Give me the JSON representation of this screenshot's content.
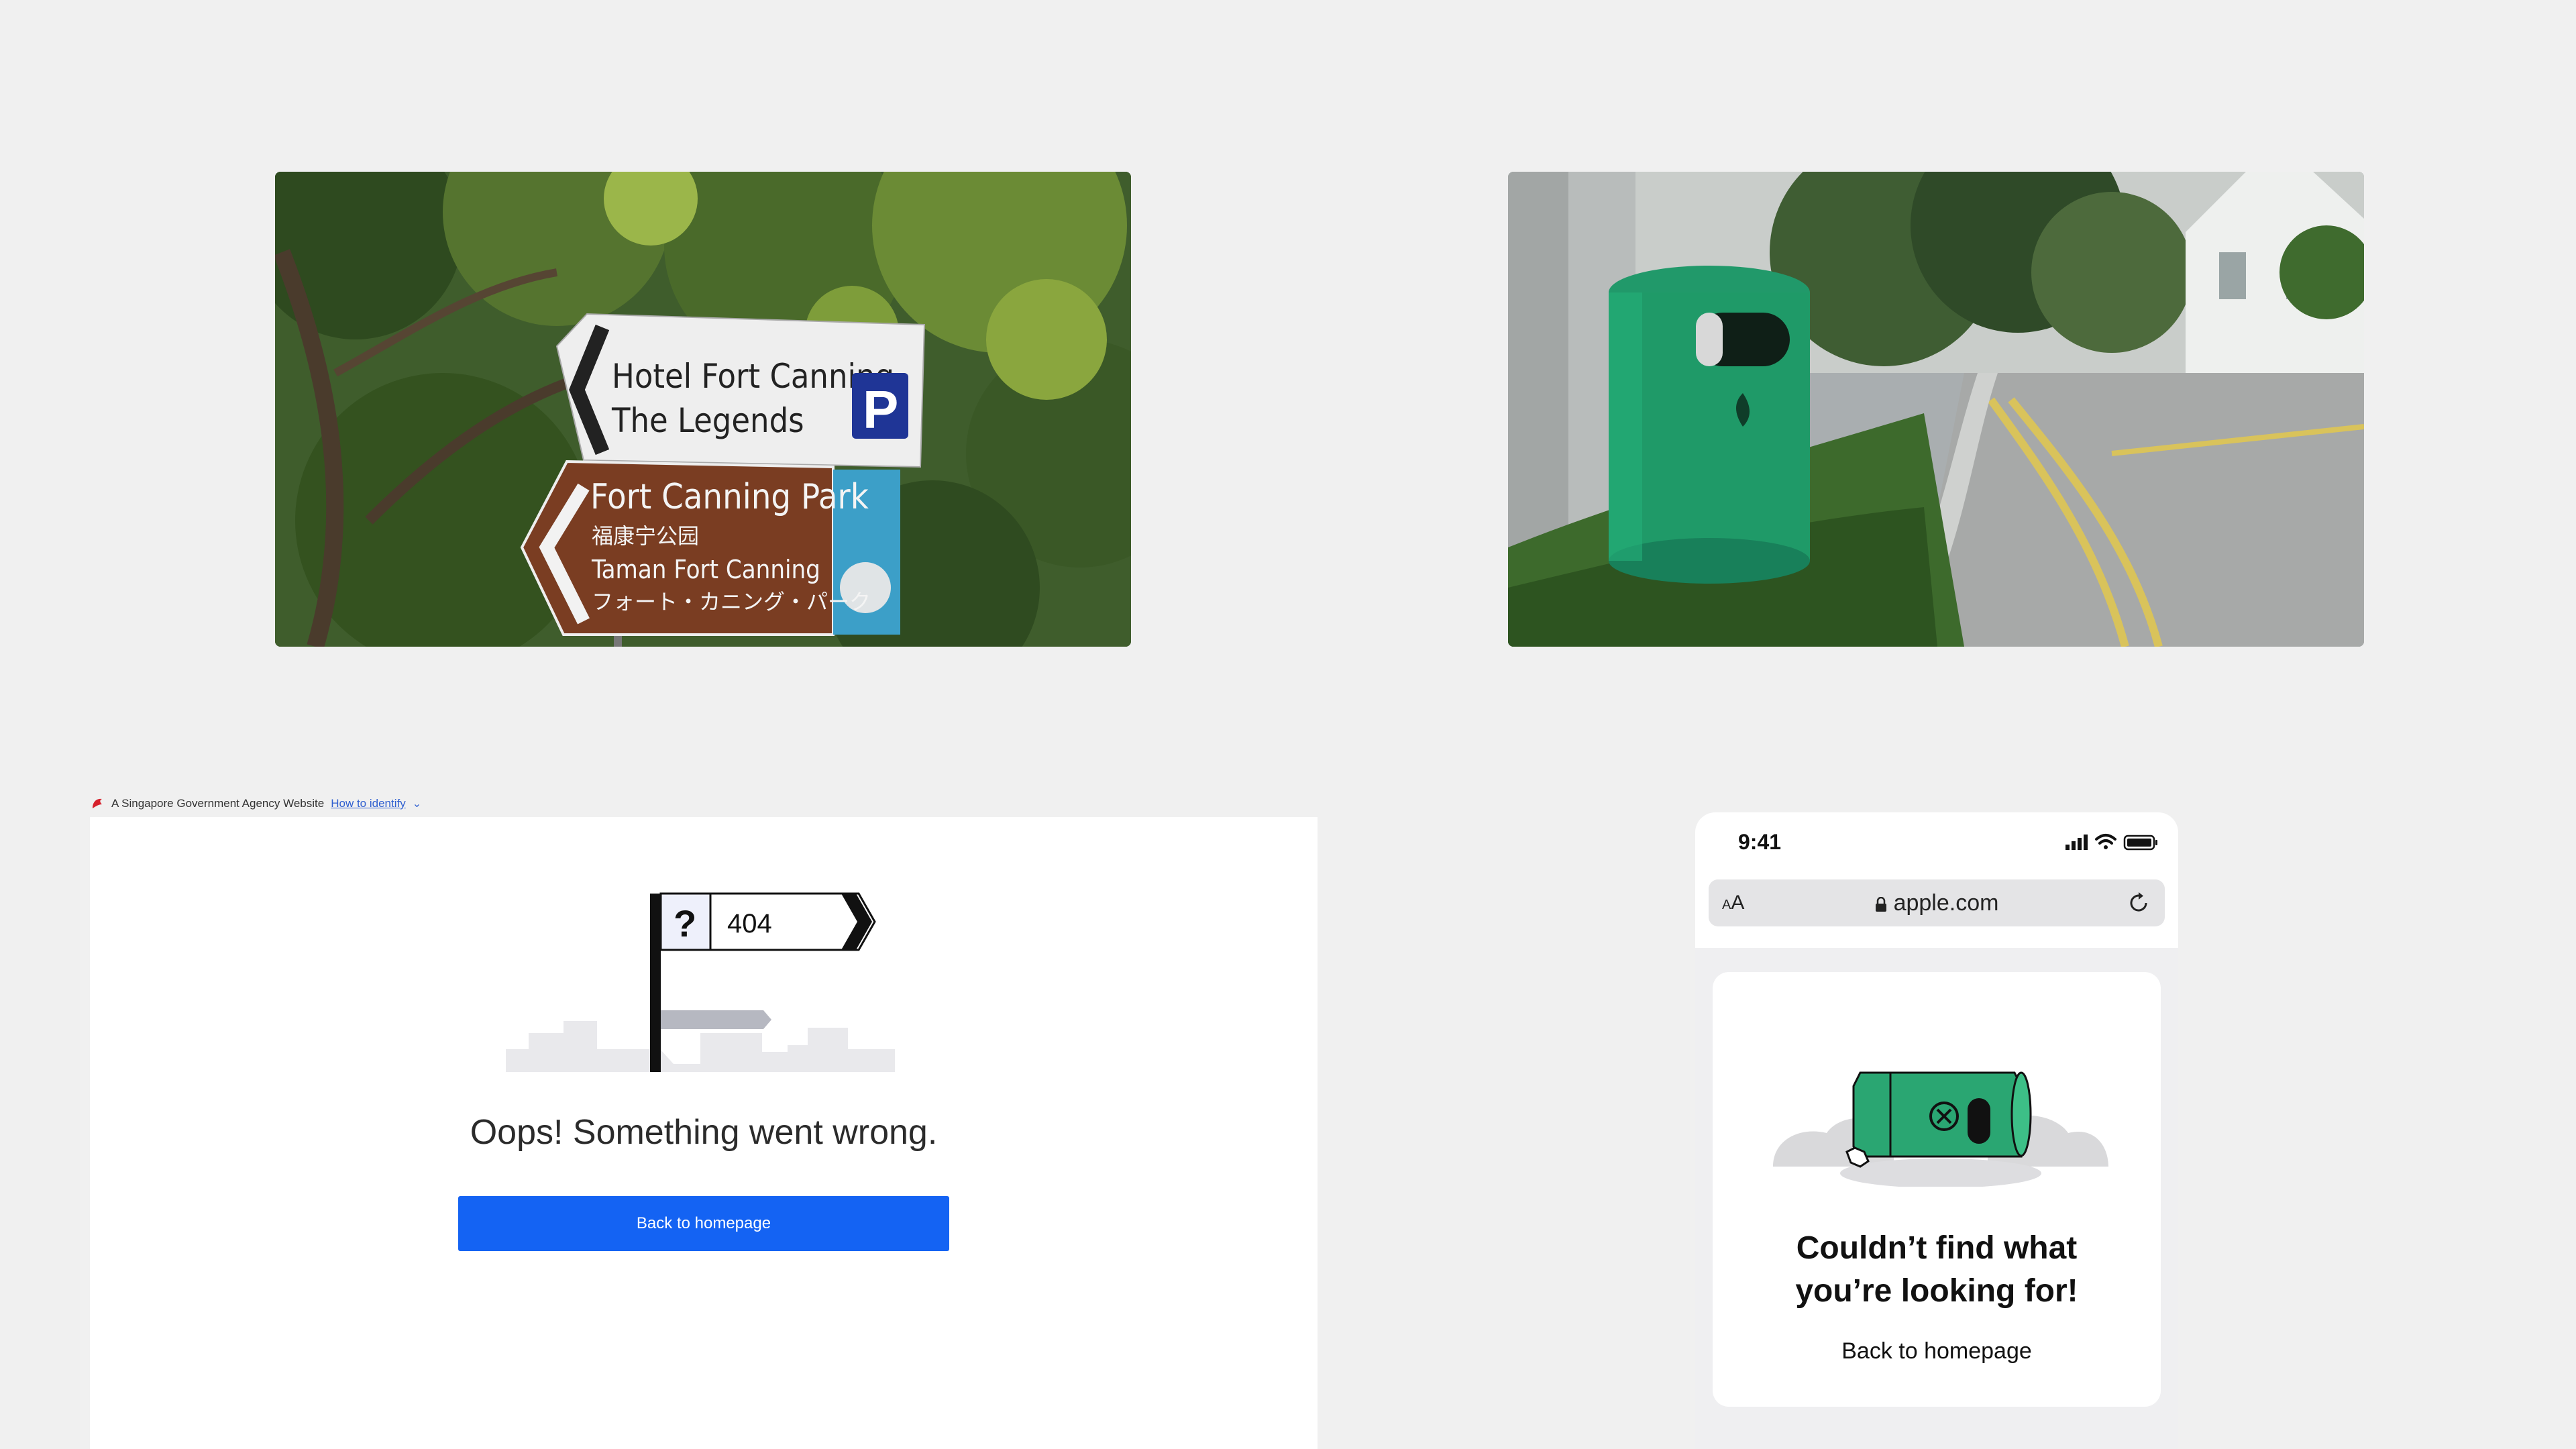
{
  "photos": {
    "signpost": {
      "sign_top_line1": "Hotel Fort Canning",
      "sign_top_line2": "The Legends",
      "parking_letter": "P",
      "sign_bottom_line1": "Fort Canning Park",
      "sign_bottom_line2": "福康宁公园",
      "sign_bottom_line3": "Taman Fort Canning",
      "sign_bottom_line4": "フォート・カニング・パーク"
    }
  },
  "web": {
    "masthead_text": "A Singapore Government Agency Website",
    "masthead_link": "How to identify",
    "sign_question": "?",
    "sign_code": "404",
    "heading": "Oops! Something went wrong.",
    "button_label": "Back to homepage",
    "button_color": "#1463f3"
  },
  "phone": {
    "time": "9:41",
    "aa_small": "A",
    "aa_large": "A",
    "url": "apple.com",
    "heading_line1": "Couldn’t find what",
    "heading_line2": "you’re looking for!",
    "back_link": "Back to homepage",
    "bin_color": "#2aa672"
  }
}
